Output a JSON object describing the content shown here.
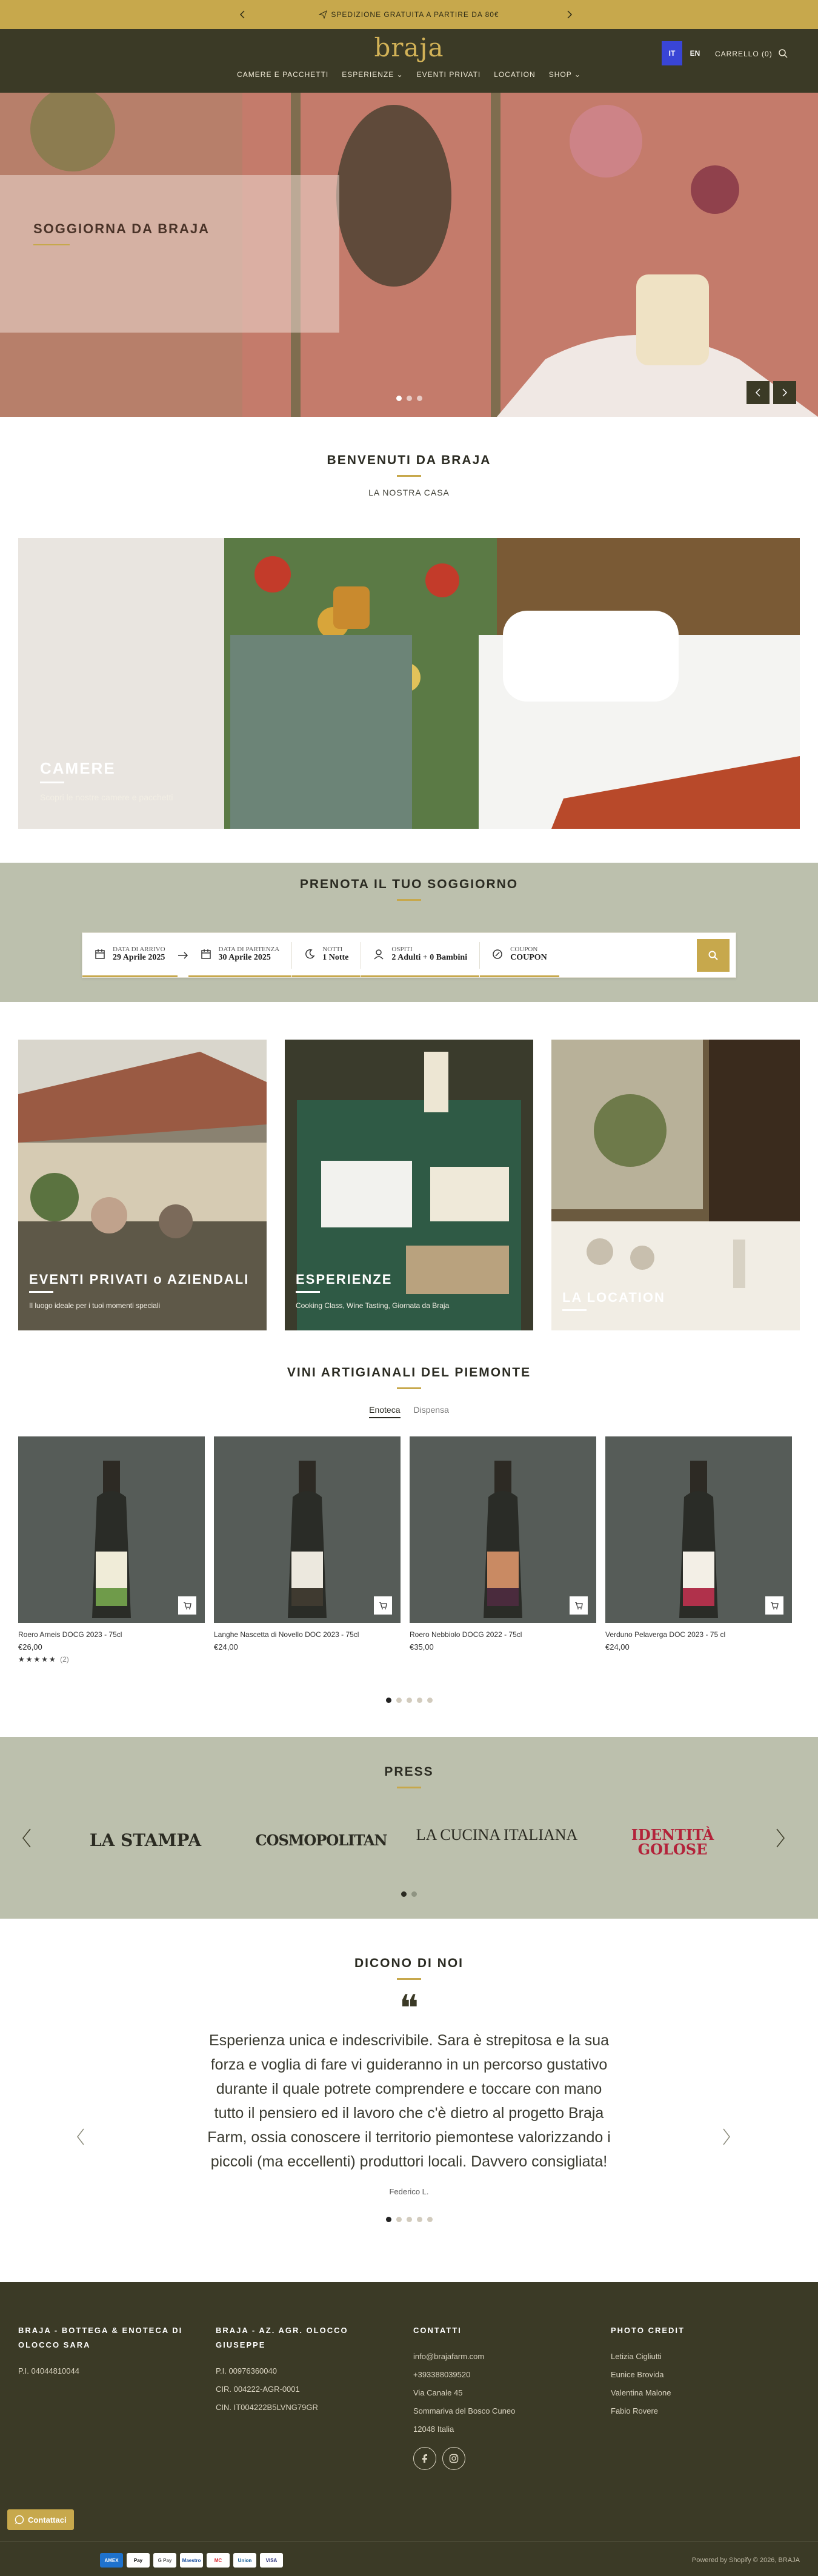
{
  "announcement": {
    "text": "SPEDIZIONE GRATUITA A PARTIRE DA 80€"
  },
  "header": {
    "logo": "braja",
    "nav": [
      "CAMERE E PACCHETTI",
      "ESPERIENZE ⌄",
      "EVENTI PRIVATI",
      "LOCATION",
      "SHOP ⌄"
    ],
    "lang_it": "IT",
    "lang_en": "EN",
    "cart": "CARRELLO (0)"
  },
  "hero": {
    "title": "SOGGIORNA DA BRAJA"
  },
  "welcome": {
    "title": "BENVENUTI DA BRAJA",
    "subtitle": "LA NOSTRA CASA"
  },
  "rooms_card": {
    "title": "CAMERE",
    "subtitle": "Scopri le nostre camere e pacchetti"
  },
  "booking": {
    "title": "PRENOTA IL TUO SOGGIORNO",
    "checkin_label": "DATA DI ARRIVO",
    "checkin_value": "29 Aprile 2025",
    "checkout_label": "DATA DI PARTENZA",
    "checkout_value": "30 Aprile 2025",
    "nights_label": "NOTTI",
    "nights_value": "1 Notte",
    "guests_label": "OSPITI",
    "guests_value": "2 Adulti + 0 Bambini",
    "coupon_label": "COUPON",
    "coupon_value": "COUPON"
  },
  "cards": [
    {
      "title": "EVENTI PRIVATI o AZIENDALI",
      "subtitle": "Il luogo ideale per i tuoi momenti speciali"
    },
    {
      "title": "ESPERIENZE",
      "subtitle": "Cooking Class, Wine Tasting, Giornata da Braja"
    },
    {
      "title": "LA LOCATION",
      "subtitle": ""
    }
  ],
  "wines": {
    "title": "VINI ARTIGIANALI DEL PIEMONTE",
    "tab_active": "Enoteca",
    "tab_other": "Dispensa",
    "products": [
      {
        "name": "Roero Arneis DOCG 2023 - 75cl",
        "price": "€26,00",
        "stars": "★★★★★",
        "reviews": "(2)",
        "label_color": "#f0ecd8",
        "accent": "#6f9b4a"
      },
      {
        "name": "Langhe Nascetta di Novello DOC 2023 - 75cl",
        "price": "€24,00",
        "stars": "",
        "reviews": "",
        "label_color": "#ece8de",
        "accent": "#3f3a30"
      },
      {
        "name": "Roero Nebbiolo DOCG 2022 - 75cl",
        "price": "€35,00",
        "stars": "",
        "reviews": "",
        "label_color": "#c98a63",
        "accent": "#4a2b3d"
      },
      {
        "name": "Verduno Pelaverga DOC 2023 - 75 cl",
        "price": "€24,00",
        "stars": "",
        "reviews": "",
        "label_color": "#f3efe6",
        "accent": "#b0314b"
      }
    ]
  },
  "press": {
    "title": "PRESS",
    "logos": [
      "LA STAMPA",
      "COSMOPOLITAN",
      "LA CUCINA ITALIANA",
      "IDENTITÀ GOLOSE"
    ]
  },
  "reviews": {
    "title": "DICONO DI NOI",
    "text": "Esperienza unica e indescrivibile. Sara è strepitosa e la sua forza e voglia di fare vi guideranno in un percorso gustativo durante il quale potrete comprendere e toccare con mano tutto il pensiero ed il lavoro che c'è dietro al progetto Braja Farm, ossia conoscere il territorio piemontese valorizzando i piccoli (ma eccellenti) produttori locali. Davvero consigliata!",
    "author": "Federico L."
  },
  "footer": {
    "col1_title": "BRAJA - BOTTEGA & ENOTECA DI OLOCCO SARA",
    "col1_lines": [
      "P.I. 04044810044"
    ],
    "col2_title": "BRAJA - AZ. AGR. OLOCCO GIUSEPPE",
    "col2_lines": [
      "P.I. 00976360040",
      "CIR. 004222-AGR-0001",
      "CIN. IT004222B5LVNG79GR"
    ],
    "col3_title": "CONTATTI",
    "col3_lines": [
      "info@brajafarm.com",
      "+393388039520",
      "Via Canale 45",
      "Sommariva del Bosco Cuneo",
      "12048 Italia"
    ],
    "col4_title": "PHOTO CREDIT",
    "col4_lines": [
      "Letizia Cigliutti",
      "Eunice Brovida",
      "Valentina Malone",
      "Fabio Rovere"
    ],
    "payments": [
      "AMEX",
      "Pay",
      "G Pay",
      "Maestro",
      "MC",
      "Union",
      "VISA"
    ],
    "powered": "Powered by Shopify   © 2026, BRAJA",
    "chat": "Contattaci"
  }
}
